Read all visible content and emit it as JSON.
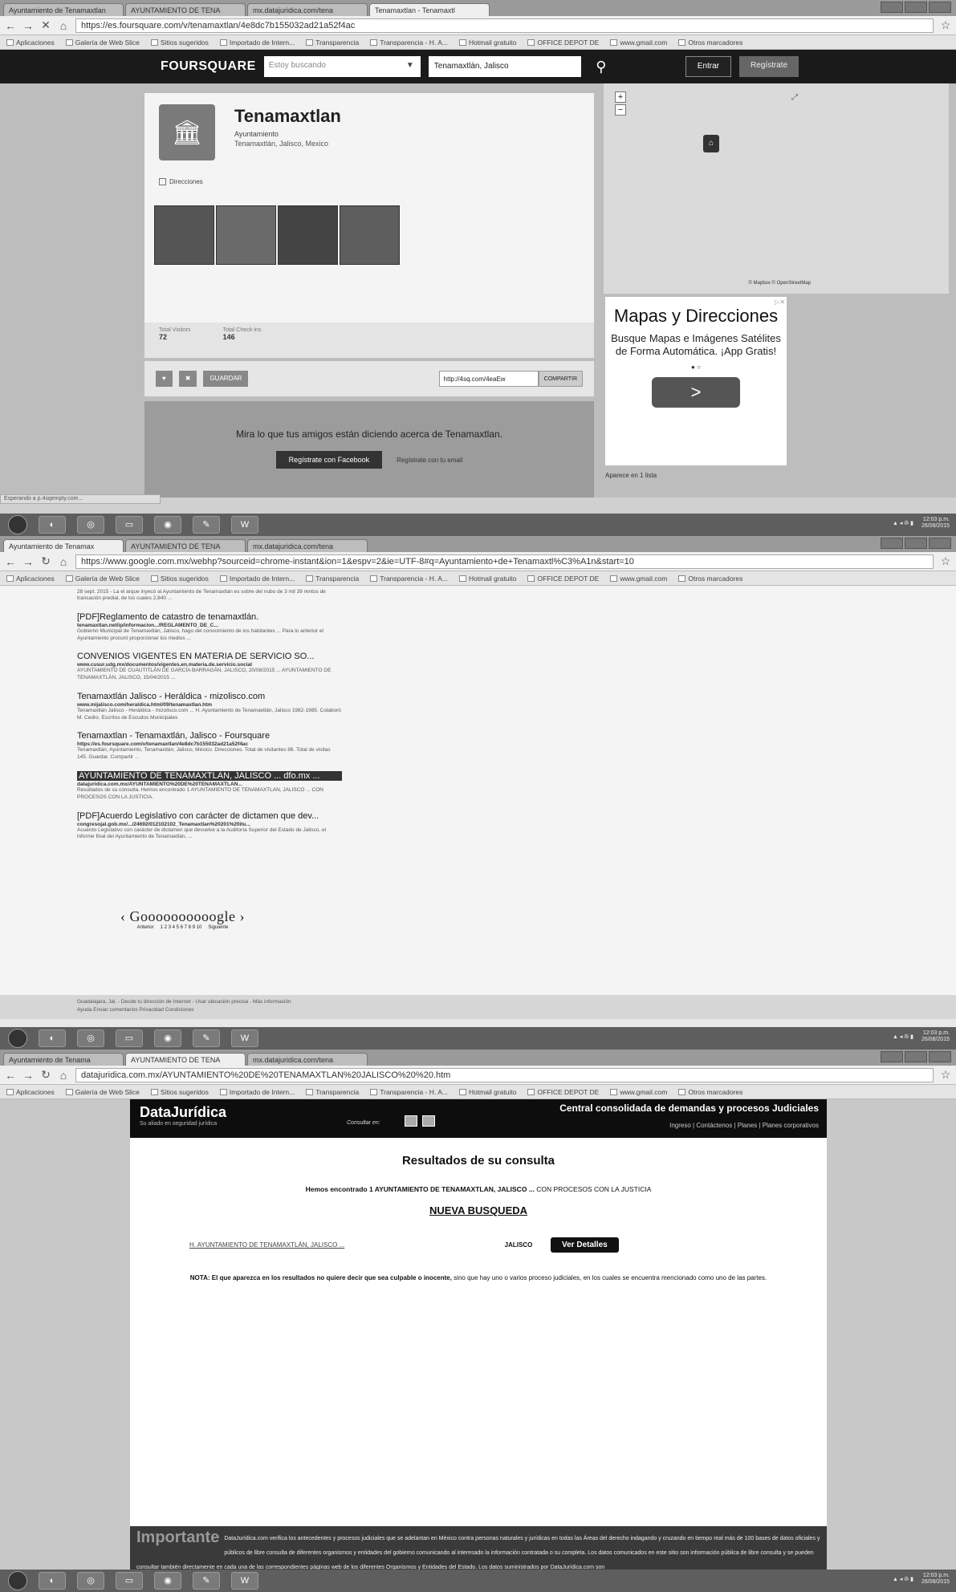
{
  "shot1": {
    "tabs": [
      "Ayuntamiento de Tenamaxtlan",
      "AYUNTAMIENTO DE TENA",
      "mx.datajuridica.com/tena",
      "Tenamaxtlan - Tenamaxtl",
      "(blank)"
    ],
    "url": "https://es.foursquare.com/v/tenamaxtlan/4e8dc7b155032ad21a52f4ac",
    "bookmarks": [
      "Aplicaciones",
      "Galería de Web Slice",
      "Sitios sugeridos",
      "Importado de Intern...",
      "Transparencia",
      "Transparencia - H. A...",
      "Hotmail gratuito",
      "OFFICE DEPOT DE",
      "www.gmail.com",
      "Otros marcadores"
    ],
    "header": {
      "logo": "FOURSQUARE",
      "search_placeholder": "Estoy buscando",
      "location": "Tenamaxtlán, Jalisco",
      "login": "Entrar",
      "register": "Regístrate"
    },
    "venue": {
      "name": "Tenamaxtlan",
      "category": "Ayuntamiento",
      "address": "Tenamaxtlán, Jalisco, Mexico",
      "directions": "Direcciones",
      "visitors_label": "Total Visitors",
      "visitors": "72",
      "checkins_label": "Total Check-ins",
      "checkins": "146",
      "save": "GUARDAR",
      "share_url": "http://4sq.com/4eaEw",
      "share_btn": "COMPARTIR"
    },
    "friends": {
      "text": "Mira lo que tus amigos están diciendo acerca de Tenamaxtlan.",
      "fb_button": "Regístrate con Facebook",
      "email": "Regístrate con tu email"
    },
    "map_credit": "© Mapbox © OpenStreetMap",
    "ad": {
      "title": "Mapas y Direcciones",
      "body": "Busque Mapas e Imágenes Satélites de Forma Automática. ¡App Gratis!",
      "button": ">"
    },
    "lists": "Aparece en 1 lista",
    "status": "Esperando a p.4sqempty.com..."
  },
  "taskbar": {
    "time1": "12:03 p.m.",
    "date1": "26/08/2015",
    "time2": "12:03 p.m.",
    "date2": "26/08/2015",
    "time3": "12:03 p.m.",
    "date3": "26/08/2015"
  },
  "shot2": {
    "tabs": [
      "Ayuntamiento de Tenamax",
      "AYUNTAMIENTO DE TENA",
      "mx.datajuridica.com/tena",
      "(blank)"
    ],
    "url": "https://www.google.com.mx/webhp?sourceid=chrome-instant&ion=1&espv=2&ie=UTF-8#q=Ayuntamiento+de+Tenamaxtl%C3%A1n&start=10",
    "snippet_top": "28 sept. 2015 - La el arque inyecó al Ayuntamiento de Tenamaxtlán es sobre del nubo de 3 mil 39 rentos de transación predial, de los cuales 2,840 ...",
    "results": [
      {
        "title": "[PDF]Reglamento de catastro de tenamaxtlán.",
        "url": "tenamaxtlan.net/ip/informacion.../REGLAMENTO_DE_C...",
        "snippet": "Gobierno Municipal de Tenamaxtlán, Jalisco, hago del conocimiento de los habitantes ... Para lo anterior el Ayuntamiento procuró proporcionar los medios ..."
      },
      {
        "title": "CONVENIOS VIGENTES EN MATERIA DE SERVICIO SO...",
        "url": "www.cusur.udg.mx/documentos/vigentes.en.materia.de.servicio.social",
        "snippet": "AYUNTAMIENTO DE CUAUTITLÁN DE GARCÍA BARRAGÁN, JALISCO, 20/08/2015 ... AYUNTAMIENTO DE TENAMAXTLÁN, JALISCO, 15/04/2015 ..."
      },
      {
        "title": "Tenamaxtlán Jalisco - Heráldica - mizolisco.com",
        "url": "www.mijalisco.com/heraldica.html/09/tenamaxtlan.htm",
        "snippet": "Tenamaxtlán Jalisco - Heráldica - mizolisco.com ... H. Ayuntamiento de Tenamaxtlán, Jalisco 1982-1985. Colaboró M. Cedro. Escritos de Escudos Municipales"
      },
      {
        "title": "Tenamaxtlan - Tenamaxtlán, Jalisco - Foursquare",
        "url": "https://es.foursquare.com/v/tenamaxtlan/4e8dc7b155032ad21a52f4ac",
        "snippet": "Tenamaxtlán, Ayuntamiento, Tenamaxtlán, Jalisco, México. Direcciones. Total de visitantes 86. Total de visitas 145. Guardar. Compartir ..."
      },
      {
        "title": "AYUNTAMIENTO DE TENAMAXTLAN, JALISCO ... dfo.mx ...",
        "url": "datajuridica.com.mx/AYUNTAMIENTO%20DE%20TENAMAXTLAN...",
        "snippet": "Resultados de su consulta. Hemos encontrado 1 AYUNTAMIENTO DE TENAMAXTLAN, JALISCO ... CON PROCESOS CON LA JUSTICIA."
      },
      {
        "title": "[PDF]Acuerdo Legislativo con carácter de dictamen que dev...",
        "url": "congresojal.gob.mx/.../24692/012102102_Tenamaxtlan%20201%20itu...",
        "snippet": "Acuerdo Legislativo con carácter de dictamen que devuelve a la Auditoría Superior del Estado de Jalisco, el informe final del Ayuntamiento de Tenamaxtlán, ..."
      }
    ],
    "pager": {
      "logo": "Goooooooooogle",
      "prev": "Anterior",
      "next": "Siguiente",
      "pages": "1 2 3 4 5 6 7 8 9 10"
    },
    "footer1": "Guadalajara, Jal. - Desde tu dirección de Internet - Usar ubicación precisa - Más información",
    "footer2": "Ayuda   Enviar comentarios   Privacidad   Condiciones"
  },
  "shot3": {
    "tabs": [
      "Ayuntamiento de Tenama",
      "AYUNTAMIENTO DE TENA",
      "mx.datajuridica.com/tena",
      "(blank)"
    ],
    "url": "datajuridica.com.mx/AYUNTAMIENTO%20DE%20TENAMAXTLAN%20JALISCO%20%20.htm",
    "logo": "DataJurídica",
    "logo_sub": "Su aliado en seguridad jurídica",
    "consult_label": "Consultar en:",
    "tagline": "Central consolidada de demandas y procesos Judiciales",
    "menu": "Ingreso | Contáctenos | Planes | Planes corporativos",
    "title": "Resultados de su consulta",
    "found_bold": "Hemos encontrado 1 AYUNTAMIENTO DE TENAMAXTLAN, JALISCO ...",
    "found_rest": " CON PROCESOS CON LA JUSTICIA",
    "new_search": "NUEVA BUSQUEDA",
    "result_link": "H. AYUNTAMIENTO DE TENAMAXTLÁN, JALISCO ...",
    "result_state": "JALISCO",
    "details_btn": "Ver Detalles",
    "nota_bold": "NOTA: El que aparezca en los resultados no quiere decir que sea culpable o inocente,",
    "nota_rest": " sino que hay uno o varios proceso judiciales, en los cuales se encuentra mencionado como uno de las partes.",
    "importante": "Importante",
    "importante_text": "DataJurídica.com verifica los antecedentes y procesos judiciales que se adelantan en México contra personas naturales y jurídicas en todas las Áreas del derecho indagando y cruzando en tiempo real más de 100 bases de datos oficiales y públicos de libre consulta de diferentes organismos y entidades del gobierno comunicando al interesado la información contratada o su completa. Los datos comunicados en este sitio son información pública de libre consulta y se pueden consultar también directamente en cada una de las correspondientes páginas web de los diferentes Organismos y Entidades del Estado. Los datos suministrados por DataJurídica.com son"
  }
}
